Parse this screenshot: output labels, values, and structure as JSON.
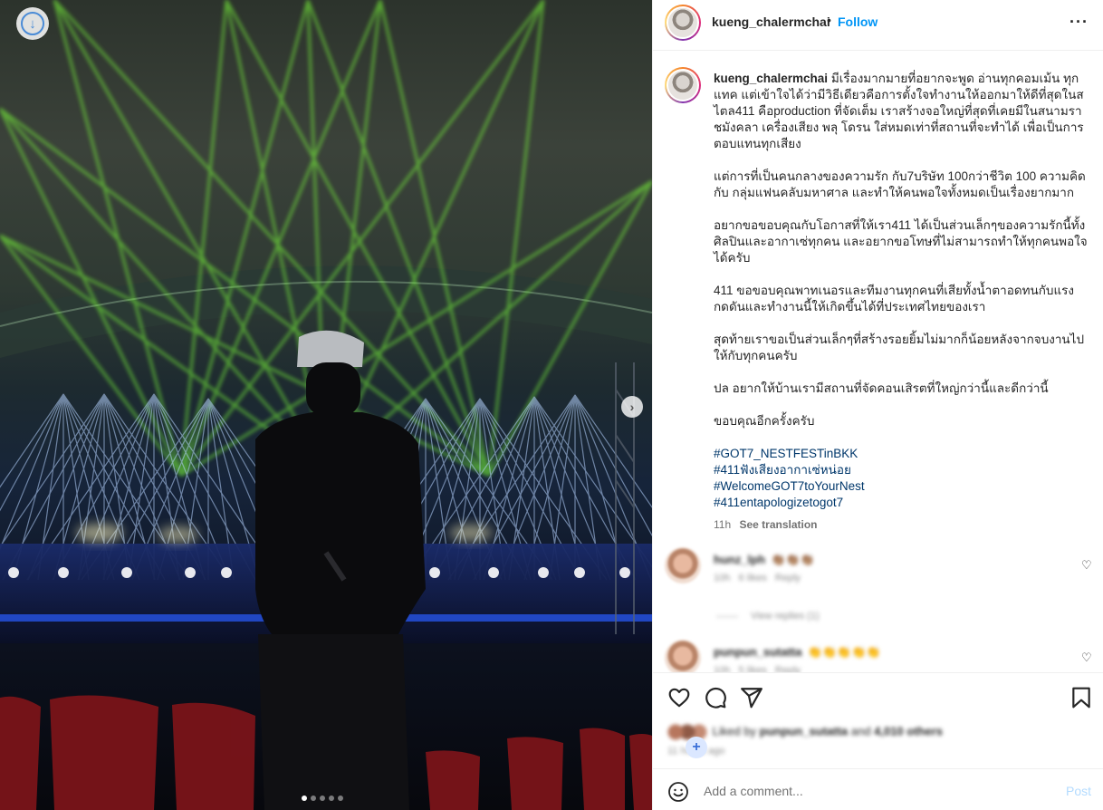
{
  "media": {
    "carousel": {
      "slide_count": 5,
      "active_index": 0
    },
    "save_icon": "download-circle-icon",
    "next_icon": "chevron-right-icon"
  },
  "post_header": {
    "username": "kueng_chalermchai",
    "separator": "•",
    "follow_label": "Follow",
    "more_icon": "more-horizontal-icon"
  },
  "caption": {
    "username": "kueng_chalermchai",
    "paragraphs": [
      "มีเรื่องมากมายที่อยากจะพูด อ่านทุกคอมเม้น ทุกแทค แต่เข้าใจได้ว่ามีวิธีเดียวคือการตั้งใจทำงานให้ออกมาให้ดีที่สุดในสไตล411 คือproduction ที่จัดเต็ม เราสร้างจอใหญ่ที่สุดที่เคยมีในสนามราชมังคลา เครื่องเสียง พลุ โดรน ใส่หมดเท่าที่สถานที่จะทำได้ เพื่อเป็นการตอบแทนทุกเสียง",
      "แต่การที่เป็นคนกลางของความรัก กับ7บริษัท 100กว่าชีวิต 100 ความคิด กับ กลุ่มแฟนคลับมหาศาล และทำให้คนพอใจทั้งหมดเป็นเรื่องยากมาก",
      "อยากขอขอบคุณกับโอกาสที่ให้เรา411 ได้เป็นส่วนเล็กๆของความรักนี้ทั้งศิลปินและอากาเซ่ทุกคน และอยากขอโทษที่ไม่สามารถทำให้ทุกคนพอใจได้ครับ",
      "411 ขอขอบคุณพาทเนอรและทีมงานทุกคนที่เสียทั้งน้ำตาอดทนกับแรงกดดันและทำงานนี้ให้เกิดขึ้นได้ที่ประเทศไทยของเรา",
      "สุดท้ายเราขอเป็นส่วนเล็กๆที่สร้างรอยยิ้มไม่มากก็น้อยหลังจากจบงานไปให้กับทุกคนครับ",
      "ปล อยากให้บ้านเรามีสถานที่จัดคอนเสิรตที่ใหญ่กว่านี้และดีกว่านี้",
      "ขอบคุณอีกครั้งครับ"
    ],
    "hashtags": [
      "#GOT7_NESTFESTinBKK",
      "#411ฟังเสียงอากาเซ่หน่อย",
      "#WelcomeGOT7toYourNest",
      "#411entapologizetogot7"
    ],
    "time": "11h",
    "see_translation": "See translation"
  },
  "comments": [
    {
      "username": "hunz_lph",
      "text": "👏🏽👏🏽👏🏽",
      "time": "10h",
      "likes": "6 likes",
      "reply": "Reply"
    },
    {
      "username": "punpun_sutatta",
      "text": "👏👏👏👏👏",
      "time": "10h",
      "likes": "5 likes",
      "reply": "Reply"
    }
  ],
  "view_replies": "View replies (1)",
  "actions": {
    "like_icon": "heart-icon",
    "comment_icon": "comment-icon",
    "share_icon": "send-icon",
    "save_icon": "bookmark-icon"
  },
  "likes": {
    "prefix": "Liked by",
    "user": "punpun_sutatta",
    "joiner": "and",
    "count": "4,010 others",
    "time_ago": "11 hours ago"
  },
  "add_comment": {
    "emoji_icon": "smiley-icon",
    "placeholder": "Add a comment...",
    "post_label": "Post"
  },
  "colors": {
    "follow_blue": "#0095f6",
    "hashtag_blue": "#00376b",
    "laser_green": "#7cff3a",
    "laser_blue": "#a9c8ff"
  }
}
